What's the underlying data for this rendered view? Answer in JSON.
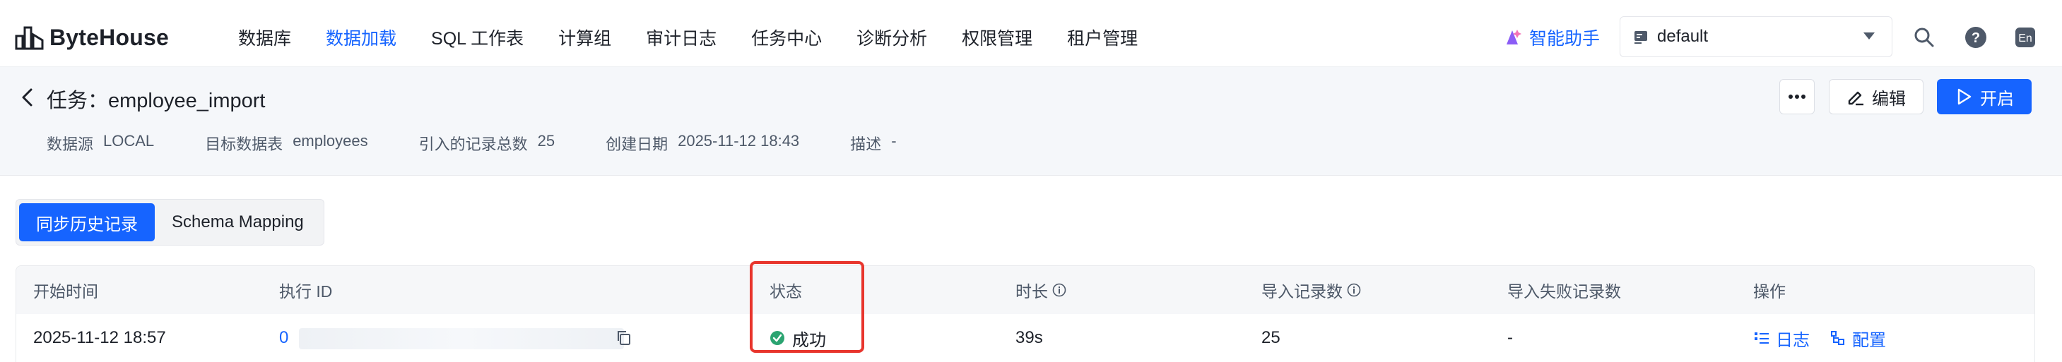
{
  "app": {
    "logo_text": "ByteHouse"
  },
  "nav": {
    "items": [
      "数据库",
      "数据加载",
      "SQL 工作表",
      "计算组",
      "审计日志",
      "任务中心",
      "诊断分析",
      "权限管理",
      "租户管理"
    ],
    "active_index": 1
  },
  "topbar": {
    "assistant_label": "智能助手",
    "database_select": "default",
    "lang_label": "En",
    "help_glyph": "?"
  },
  "task": {
    "title": "任务：employee_import",
    "meta": {
      "source_label": "数据源",
      "source_value": "LOCAL",
      "target_label": "目标数据表",
      "target_value": "employees",
      "count_label": "引入的记录总数",
      "count_value": "25",
      "created_label": "创建日期",
      "created_value": "2025-11-12 18:43",
      "desc_label": "描述",
      "desc_value": "-"
    },
    "actions": {
      "edit_label": "编辑",
      "start_label": "开启"
    }
  },
  "tabs": [
    {
      "label": "同步历史记录",
      "active": true
    },
    {
      "label": "Schema Mapping",
      "active": false
    }
  ],
  "table": {
    "headers": {
      "start_time": "开始时间",
      "exec_id": "执行 ID",
      "status": "状态",
      "duration": "时长",
      "imported": "导入记录数",
      "failed": "导入失败记录数",
      "ops": "操作"
    },
    "rows": [
      {
        "start_time": "2025-11-12 18:57",
        "exec_id": "0",
        "status": "成功",
        "duration": "39s",
        "imported": "25",
        "failed": "-",
        "op_log": "日志",
        "op_config": "配置"
      }
    ]
  },
  "colors": {
    "accent": "#1664ff",
    "success": "#2ba471",
    "highlight": "#e8352d",
    "assistant": "#8b5cf6"
  },
  "icons": [
    "bytehouse-logo-icon",
    "sparkle-icon",
    "database-icon",
    "search-icon",
    "help-icon",
    "language-icon",
    "back-arrow-icon",
    "more-icon",
    "edit-icon",
    "play-icon",
    "info-icon",
    "copy-icon",
    "check-circle-icon",
    "log-icon",
    "config-icon"
  ]
}
